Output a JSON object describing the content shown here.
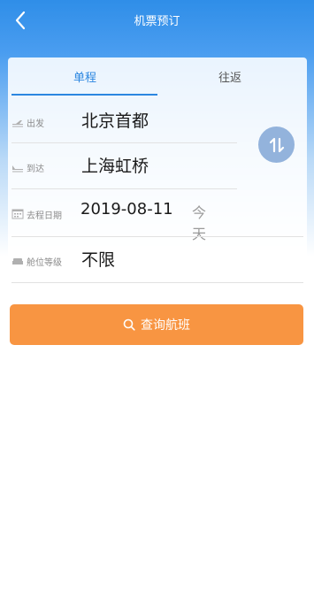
{
  "nav": {
    "title": "机票预订",
    "back_icon": "chevron-left-icon"
  },
  "tabs": [
    {
      "label": "单程",
      "active": true
    },
    {
      "label": "往返",
      "active": false
    }
  ],
  "form": {
    "departure": {
      "label": "出发",
      "value": "北京首都",
      "icon": "plane-takeoff-icon"
    },
    "arrival": {
      "label": "到达",
      "value": "上海虹桥",
      "icon": "plane-landing-icon"
    },
    "date": {
      "label": "去程日期",
      "value": "2019-08-11",
      "hint": "今天",
      "icon": "calendar-icon"
    },
    "cabin": {
      "label": "舱位等级",
      "value": "不限",
      "icon": "seat-icon"
    }
  },
  "search": {
    "label": "查询航班",
    "icon": "search-icon"
  },
  "colors": {
    "primary": "#2b86e0",
    "accent": "#f89542",
    "swap": "#93b3dc"
  }
}
